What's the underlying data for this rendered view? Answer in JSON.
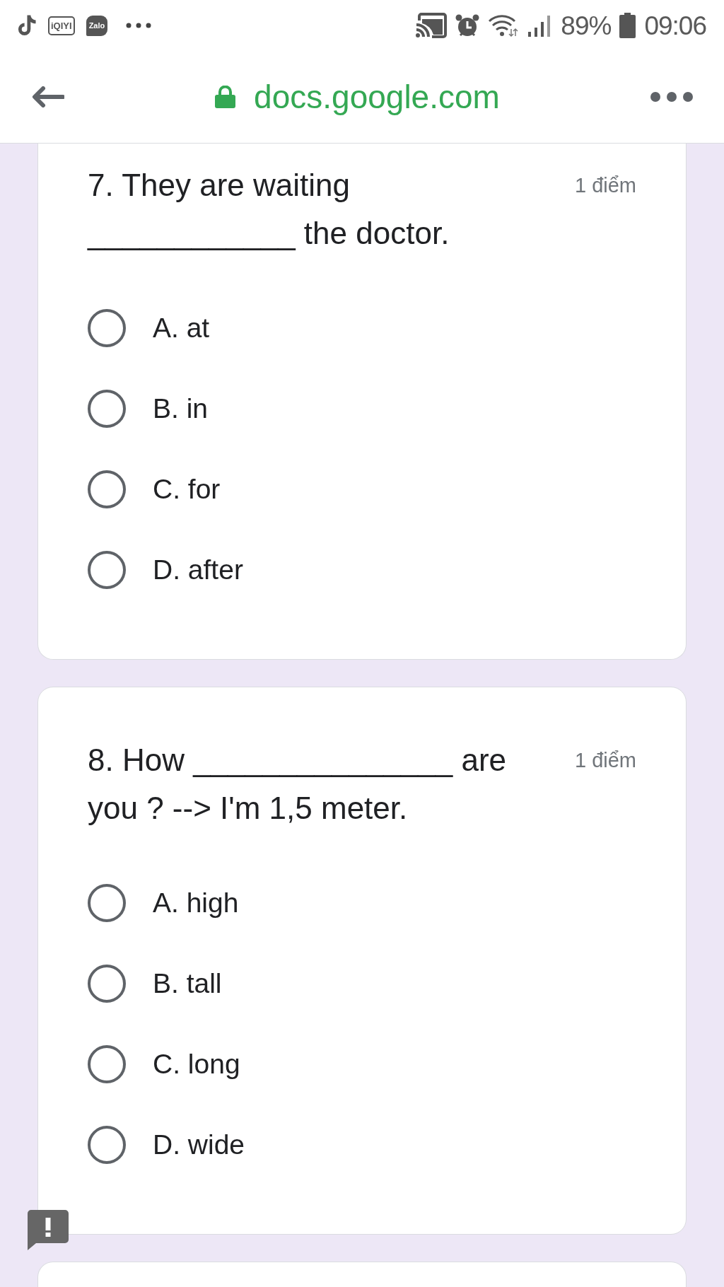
{
  "status_bar": {
    "notifications": [
      {
        "kind": "note"
      },
      {
        "kind": "boxed_logo",
        "text": "iQIYI"
      },
      {
        "kind": "bubble_logo",
        "text": "Zalo"
      },
      {
        "kind": "more"
      }
    ],
    "battery": "89%",
    "time": "09:06"
  },
  "address_bar": {
    "url": "docs.google.com"
  },
  "questions": [
    {
      "title": "7. They are waiting ____________ the doctor.",
      "points": "1 điểm",
      "options": [
        {
          "label": "A. at",
          "selected": false
        },
        {
          "label": "B. in",
          "selected": false
        },
        {
          "label": "C. for",
          "selected": false
        },
        {
          "label": "D. after",
          "selected": false
        }
      ]
    },
    {
      "title": "8. How _______________ are you ? --> I'm 1,5 meter.",
      "points": "1 điểm",
      "options": [
        {
          "label": "A. high",
          "selected": false
        },
        {
          "label": "B. tall",
          "selected": false
        },
        {
          "label": "C. long",
          "selected": false
        },
        {
          "label": "D. wide",
          "selected": false
        }
      ]
    }
  ]
}
